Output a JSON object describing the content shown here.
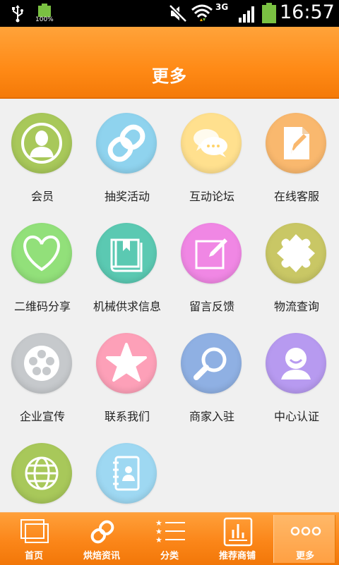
{
  "status_bar": {
    "battery_small_label": "100%",
    "network_type": "3G",
    "time": "16:57"
  },
  "header": {
    "title": "更多"
  },
  "grid": {
    "items": [
      {
        "label": "会员",
        "icon": "member-icon",
        "color": "#a8c85a"
      },
      {
        "label": "抽奖活动",
        "icon": "chain-link-icon",
        "color": "#8fd3ee"
      },
      {
        "label": "互动论坛",
        "icon": "speech-bubbles-icon",
        "color": "#ffe08e"
      },
      {
        "label": "在线客服",
        "icon": "document-edit-icon",
        "color": "#f9b86e"
      },
      {
        "label": "二维码分享",
        "icon": "heart-icon",
        "color": "#92e07a"
      },
      {
        "label": "机械供求信息",
        "icon": "book-icon",
        "color": "#5bc9b2"
      },
      {
        "label": "留言反馈",
        "icon": "edit-note-icon",
        "color": "#f087e4"
      },
      {
        "label": "物流查询",
        "icon": "puzzle-icon",
        "color": "#c9c765"
      },
      {
        "label": "企业宣传",
        "icon": "film-reel-icon",
        "color": "#c6c9cc"
      },
      {
        "label": "联系我们",
        "icon": "star-icon",
        "color": "#fda0b8"
      },
      {
        "label": "商家入驻",
        "icon": "magnifier-icon",
        "color": "#8fb0e3"
      },
      {
        "label": "中心认证",
        "icon": "user-smile-icon",
        "color": "#b79af0"
      },
      {
        "label": "",
        "icon": "globe-icon",
        "color": "#a8c85a"
      },
      {
        "label": "",
        "icon": "contact-book-icon",
        "color": "#9ed8f2"
      }
    ]
  },
  "tabbar": {
    "tabs": [
      {
        "label": "首页",
        "icon": "home-pages-icon",
        "active": false
      },
      {
        "label": "烘焙资讯",
        "icon": "chain-link-icon",
        "active": false
      },
      {
        "label": "分类",
        "icon": "star-list-icon",
        "active": false
      },
      {
        "label": "推荐商铺",
        "icon": "bar-chart-icon",
        "active": false
      },
      {
        "label": "更多",
        "icon": "more-dots-icon",
        "active": true
      }
    ]
  },
  "colors": {
    "header_orange": "#ff8a16",
    "tab_orange": "#fb8619",
    "background": "#f0f0f0"
  }
}
